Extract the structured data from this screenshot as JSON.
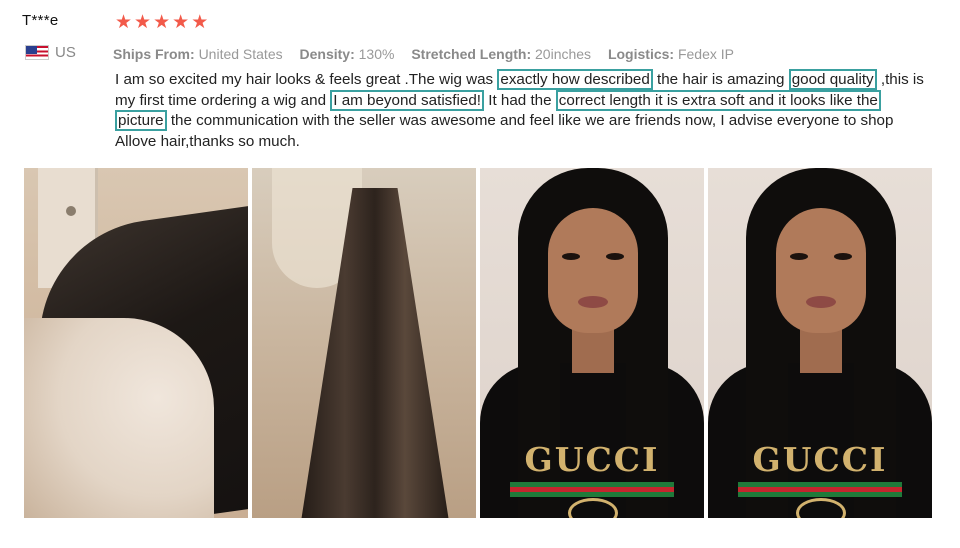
{
  "reviewer": {
    "name": "T***e",
    "country_code": "US",
    "flag_icon": "us-flag-icon"
  },
  "rating": {
    "stars": 5,
    "max": 5,
    "star_glyph": "★",
    "star_color": "#f25a4a"
  },
  "meta": {
    "ships_from_label": "Ships From:",
    "ships_from_value": "United States",
    "density_label": "Density:",
    "density_value": "130%",
    "length_label": "Stretched Length:",
    "length_value": "20inches",
    "logistics_label": "Logistics:",
    "logistics_value": "Fedex IP"
  },
  "review": {
    "seg1": "I am so excited my hair looks & feels great .The wig was ",
    "hl1": "exactly how described",
    "seg2": " the hair is amazing ",
    "hl2": "good quality",
    "seg3": " ,this is my first time ordering a wig and ",
    "hl3": " I am beyond satisfied!",
    "seg4": " It had the ",
    "hl4": "correct length it is extra soft and it looks like the",
    "seg5": " ",
    "hl5": "picture",
    "seg6": " the communication with the seller was awesome and feel like we are friends now, I advise everyone to shop Allove hair,thanks so much.",
    "highlight_color": "#3aa0a0"
  },
  "photos": {
    "brand_text_3": "GUCCI",
    "brand_text_4": "GUCCI"
  }
}
